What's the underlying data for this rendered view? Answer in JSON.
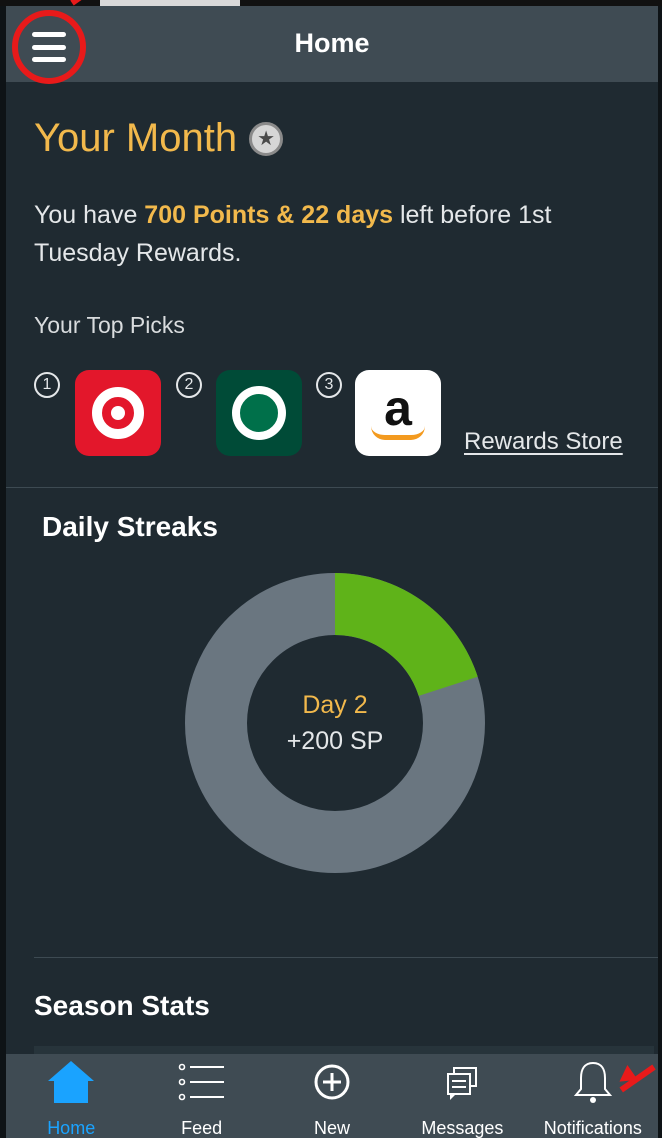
{
  "header": {
    "title": "Home"
  },
  "month": {
    "title": "Your Month",
    "text_prefix": "You have ",
    "text_highlight": "700 Points & 22 days",
    "text_suffix": " left before 1st Tuesday Rewards.",
    "picks_label": "Your Top Picks",
    "picks": [
      {
        "number": "1",
        "brand": "target-logo"
      },
      {
        "number": "2",
        "brand": "starbucks-logo"
      },
      {
        "number": "3",
        "brand": "amazon-logo"
      }
    ],
    "amazon_letter": "a",
    "rewards_link": "Rewards Store"
  },
  "streaks": {
    "title": "Daily Streaks",
    "day_label": "Day 2",
    "points_label": "+200 SP",
    "progress_fraction": 0.2,
    "progress_color": "#5fb319",
    "track_color": "#6a7680"
  },
  "season": {
    "title": "Season Stats"
  },
  "tabbar": {
    "tabs": [
      {
        "label": "Home",
        "icon": "home-icon",
        "active": true
      },
      {
        "label": "Feed",
        "icon": "list-icon",
        "active": false
      },
      {
        "label": "New",
        "icon": "plus-circle-icon",
        "active": false
      },
      {
        "label": "Messages",
        "icon": "messages-icon",
        "active": false
      },
      {
        "label": "Notifications",
        "icon": "bell-icon",
        "active": false
      }
    ]
  },
  "colors": {
    "accent": "#f2b94c",
    "active_tab": "#1aa3ff",
    "annotation": "#e81a1a"
  }
}
